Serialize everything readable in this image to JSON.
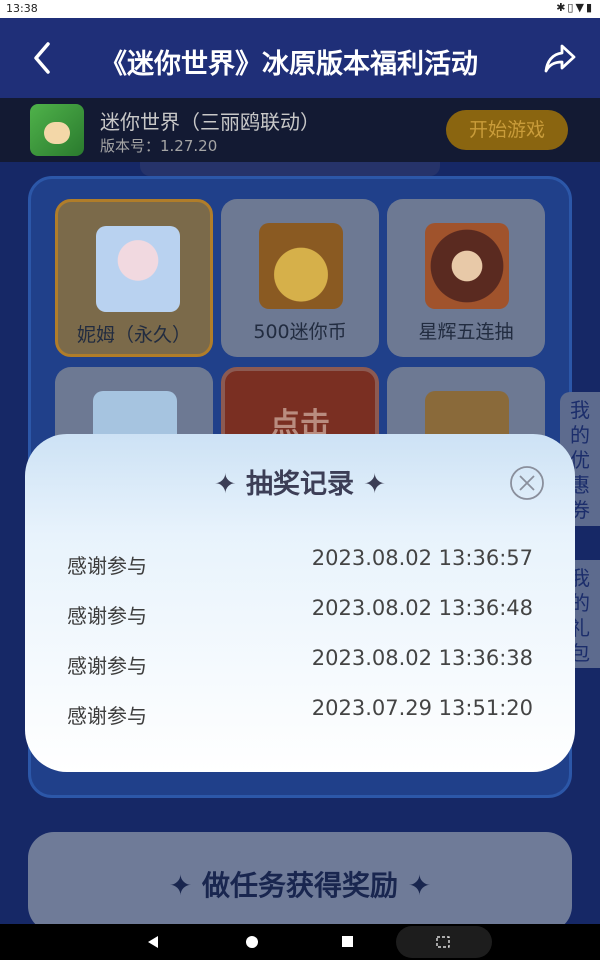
{
  "status_bar": {
    "time": "13:38",
    "icons": [
      "bluetooth-icon",
      "vibrate-icon",
      "wifi-icon",
      "battery-icon"
    ]
  },
  "header": {
    "title": "《迷你世界》冰原版本福利活动",
    "back_icon": "chevron-left-icon",
    "share_icon": "share-icon"
  },
  "game": {
    "name": "迷你世界（三丽鸥联动）",
    "version": "版本号：1.27.20",
    "start_button": "开始游戏"
  },
  "prizes": [
    {
      "label": "妮姆（永久）",
      "icon": "character-icon",
      "selected": true,
      "color": "#b9d2f0"
    },
    {
      "label": "500迷你币",
      "icon": "treasure-chest-icon",
      "selected": false,
      "color": "#c69a3a"
    },
    {
      "label": "星辉五连抽",
      "icon": "character-icon",
      "selected": false,
      "color": "#7a3a28"
    }
  ],
  "draw_button": {
    "label": "点击"
  },
  "side_tabs": [
    {
      "label": "我的优惠券"
    },
    {
      "label": "我的礼包"
    }
  ],
  "task_section": {
    "title": "✦ 做任务获得奖励 ✦"
  },
  "modal": {
    "title": "✦ 抽奖记录 ✦",
    "records": [
      {
        "label": "感谢参与",
        "time": "2023.08.02 13:36:57"
      },
      {
        "label": "感谢参与",
        "time": "2023.08.02 13:36:48"
      },
      {
        "label": "感谢参与",
        "time": "2023.08.02 13:36:38"
      },
      {
        "label": "感谢参与",
        "time": "2023.07.29 13:51:20"
      }
    ]
  },
  "colors": {
    "header_bg": "#1f2f78",
    "accent_gold": "#b07d2a",
    "modal_title": "#3c3e56"
  }
}
